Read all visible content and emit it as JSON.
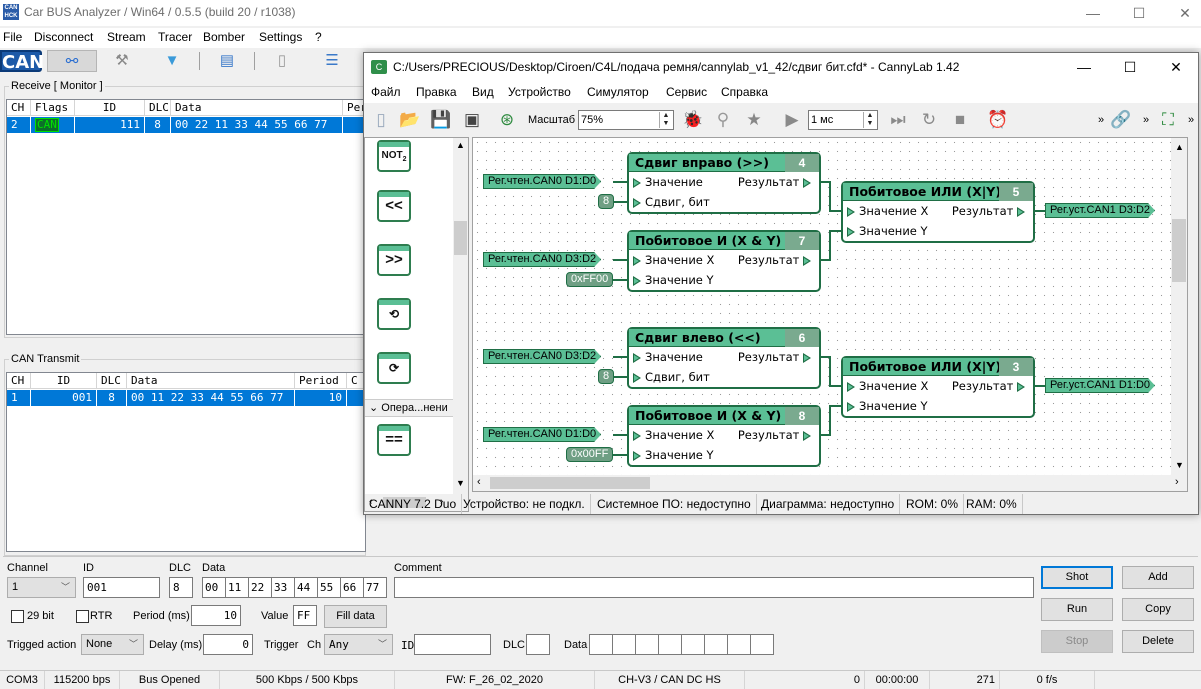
{
  "main_window": {
    "title": "Car BUS Analyzer / Win64 / 0.5.5 (build 20 / r1038)",
    "controls": {
      "minimize": "—",
      "maximize": "☐",
      "close": "✕"
    },
    "menu": [
      "File",
      "Disconnect",
      "Stream",
      "Tracer",
      "Bomber",
      "Settings",
      "?"
    ],
    "logo_text": "CAN",
    "toolbar_icons": [
      "connect-icon",
      "tools-icon",
      "filter-icon",
      "print-icon",
      "new-document-icon",
      "list-view-icon"
    ]
  },
  "receive": {
    "title": "Receive [ Monitor ]",
    "columns": [
      "CH",
      "Flags",
      "ID",
      "DLC",
      "Data",
      "Per"
    ],
    "rows": [
      {
        "ch": "2",
        "flags": "CAN",
        "id": "111",
        "dlc": "8",
        "data": "00 22 11 33 44 55 66 77",
        "period": ""
      }
    ]
  },
  "transmit": {
    "title": "CAN Transmit",
    "columns": [
      "CH",
      "ID",
      "DLC",
      "Data",
      "Period",
      "C"
    ],
    "rows": [
      {
        "ch": "1",
        "id": "001",
        "dlc": "8",
        "data": "00 11 22 33 44 55 66 77",
        "period": "10"
      }
    ]
  },
  "form": {
    "channel_label": "Channel",
    "channel_value": "1",
    "id_label": "ID",
    "id_value": "001",
    "dlc_label": "DLC",
    "dlc_value": "8",
    "data_label": "Data",
    "data_bytes": [
      "00",
      "11",
      "22",
      "33",
      "44",
      "55",
      "66",
      "77"
    ],
    "comment_label": "Comment",
    "comment_value": "",
    "bit29_label": "29 bit",
    "bit29_checked": false,
    "rtr_label": "RTR",
    "rtr_checked": false,
    "period_label": "Period (ms)",
    "period_value": "10",
    "value_label": "Value",
    "value_value": "FF",
    "fill_button": "Fill data",
    "trigged_action_label": "Trigged action",
    "trigged_action_value": "None",
    "delay_label": "Delay (ms)",
    "delay_value": "0",
    "trigger_label": "Trigger",
    "trigger_ch_label": "Ch",
    "trigger_ch_value": "Any",
    "trigger_id_label": "ID",
    "trigger_id_value": "",
    "trigger_dlc_label": "DLC",
    "trigger_dlc_value": "",
    "trigger_data_label": "Data",
    "buttons": {
      "shot": "Shot",
      "add": "Add",
      "run": "Run",
      "copy": "Copy",
      "stop": "Stop",
      "delete": "Delete"
    }
  },
  "statusbar": {
    "port": "COM3",
    "baud": "115200 bps",
    "bus": "Bus Opened",
    "speed": "500 Kbps / 500 Kbps",
    "fw": "FW: F_26_02_2020",
    "hw": "CH-V3 / CAN DC HS",
    "count": "0",
    "time": "00:00:00",
    "frames": "271",
    "rate": "0 f/s"
  },
  "cannylab": {
    "title": "C:/Users/PRECIOUS/Desktop/Ciroen/C4L/подача ремня/cannylab_v1_42/сдвиг бит.cfd* - CannyLab 1.42",
    "menu": [
      "Файл",
      "Правка",
      "Вид",
      "Устройство",
      "Симулятор",
      "Сервис",
      "Справка"
    ],
    "zoom_label": "Масштаб",
    "zoom_value": "75%",
    "sim_period": "1 мс",
    "palette": {
      "items": [
        "NOT2",
        "<<",
        ">>",
        "rotate-left",
        "rotate-right"
      ],
      "section": "Опера...нени",
      "section_items": [
        "=="
      ]
    },
    "blocks": [
      {
        "num": "4",
        "title": "Сдвиг вправо (>>)",
        "inputs": [
          "Значение",
          "Сдвиг, бит"
        ],
        "output": "Результат"
      },
      {
        "num": "7",
        "title": "Побитовое И (X & Y)",
        "inputs": [
          "Значение X",
          "Значение Y"
        ],
        "output": "Результат"
      },
      {
        "num": "5",
        "title": "Побитовое ИЛИ (X|Y)",
        "inputs": [
          "Значение X",
          "Значение Y"
        ],
        "output": "Результат"
      },
      {
        "num": "6",
        "title": "Сдвиг влево (<<)",
        "inputs": [
          "Значение",
          "Сдвиг, бит"
        ],
        "output": "Результат"
      },
      {
        "num": "8",
        "title": "Побитовое И (X & Y)",
        "inputs": [
          "Значение X",
          "Значение Y"
        ],
        "output": "Результат"
      },
      {
        "num": "3",
        "title": "Побитовое ИЛИ (X|Y)",
        "inputs": [
          "Значение X",
          "Значение Y"
        ],
        "output": "Результат"
      }
    ],
    "tags": {
      "in1": "Рег.чтен.CAN0 D1:D0",
      "in2": "Рег.чтен.CAN0 D3:D2",
      "in3": "Рег.чтен.CAN0 D3:D2",
      "in4": "Рег.чтен.CAN0 D1:D0",
      "out1": "Рег.уст.CAN1 D3:D2",
      "out2": "Рег.уст.CAN1 D1:D0"
    },
    "constants": {
      "c1": "8",
      "c2": "0xFF00",
      "c3": "8",
      "c4": "0x00FF"
    },
    "status": [
      "CANNY 7.2 Duo",
      "Устройство: не подкл.",
      "Системное ПО: недоступно",
      "Диаграмма: недоступно",
      "ROM: 0%",
      "RAM: 0%"
    ]
  }
}
